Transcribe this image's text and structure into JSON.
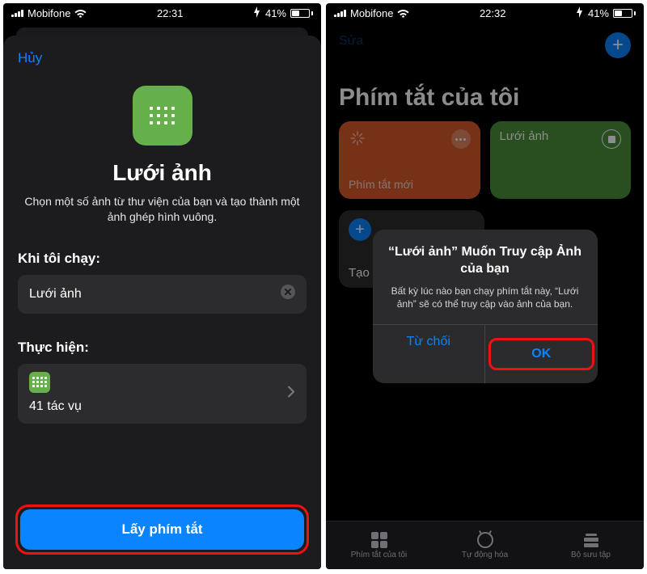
{
  "left": {
    "status": {
      "carrier": "Mobifone",
      "time": "22:31",
      "battery": "41%"
    },
    "cancel": "Hủy",
    "title": "Lưới ảnh",
    "description": "Chọn một số ảnh từ thư viện của bạn và tạo thành một ảnh ghép hình vuông.",
    "when_label": "Khi tôi chạy:",
    "shortcut_name": "Lưới ảnh",
    "do_label": "Thực hiện:",
    "task_count": "41 tác vụ",
    "primary": "Lấy phím tắt"
  },
  "right": {
    "status": {
      "carrier": "Mobifone",
      "time": "22:32",
      "battery": "41%"
    },
    "edit": "Sửa",
    "page_title": "Phím tắt của tôi",
    "tiles": {
      "orange": "Phím tắt mới",
      "green": "Lưới ảnh",
      "create": "Tạo phím tắt"
    },
    "alert": {
      "title": "“Lưới ảnh” Muốn Truy cập Ảnh của bạn",
      "message": "Bất kỳ lúc nào bạn chạy phím tắt này, “Lưới ảnh” sẽ có thể truy cập vào ảnh của bạn.",
      "deny": "Từ chối",
      "ok": "OK"
    },
    "tabs": {
      "a": "Phím tắt của tôi",
      "b": "Tự động hóa",
      "c": "Bộ sưu tập"
    }
  }
}
